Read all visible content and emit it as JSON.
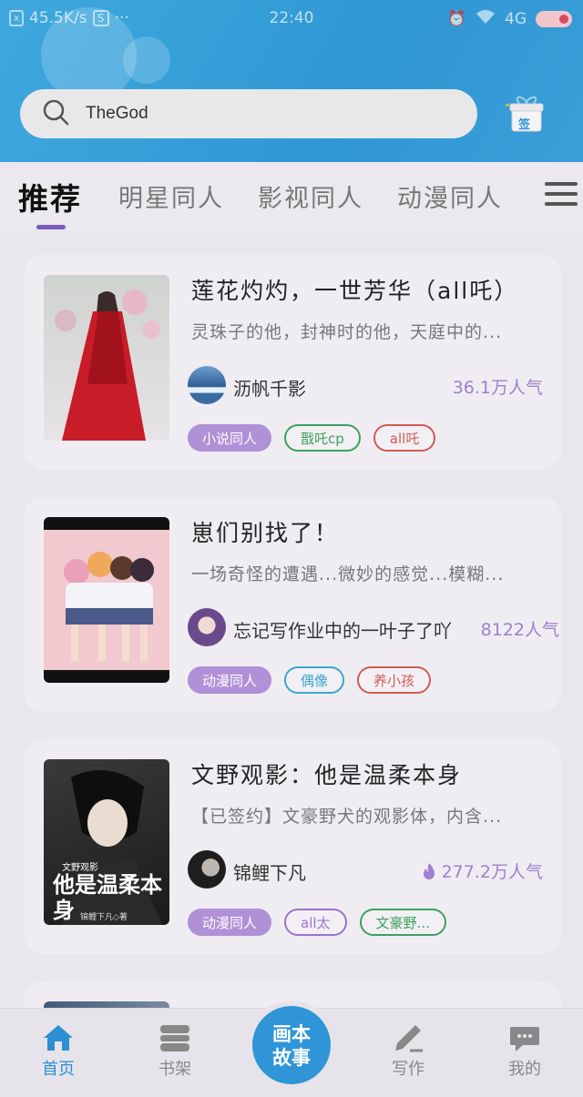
{
  "status_bar": {
    "speed": "45.5K/s",
    "time": "22:40",
    "signal": "4G"
  },
  "search": {
    "query": "TheGod",
    "icon": "search-icon"
  },
  "sign_in": {
    "label": "签"
  },
  "tabs": [
    {
      "label": "推荐"
    },
    {
      "label": "明星同人"
    },
    {
      "label": "影视同人"
    },
    {
      "label": "动漫同人"
    }
  ],
  "cards": [
    {
      "title": "莲花灼灼，一世芳华（all吒）",
      "desc": "灵珠子的他，封神时的他，天庭中的...",
      "author": "沥帆千影",
      "popularity": "36.1万人气",
      "tags": [
        {
          "label": "小说同人",
          "style": "purple"
        },
        {
          "label": "戬吒cp",
          "style": "green"
        },
        {
          "label": "all吒",
          "style": "red"
        }
      ]
    },
    {
      "title": "崽们别找了！",
      "desc": "一场奇怪的遭遇...微妙的感觉...模糊...",
      "author": "忘记写作业中的一叶子了吖",
      "popularity": "8122人气",
      "tags": [
        {
          "label": "动漫同人",
          "style": "purple"
        },
        {
          "label": "偶像",
          "style": "blue"
        },
        {
          "label": "养小孩",
          "style": "red"
        }
      ]
    },
    {
      "title": "文野观影：他是温柔本身",
      "desc": "【已签约】文豪野犬的观影体，内含...",
      "author": "锦鲤下凡",
      "popularity": "277.2万人气",
      "cover_text": "他是温柔本身",
      "cover_small": "文野观影",
      "cover_author": "锦鲤下凡◇著",
      "tags": [
        {
          "label": "动漫同人",
          "style": "purple"
        },
        {
          "label": "all太",
          "style": "violet"
        },
        {
          "label": "文豪野...",
          "style": "green"
        }
      ]
    }
  ],
  "bottom_nav": {
    "home": "首页",
    "bookshelf": "书架",
    "center": [
      "画本",
      "故事"
    ],
    "write": "写作",
    "mine": "我的"
  },
  "colors": {
    "brand": "#2f95d6",
    "accent": "#7a5bc0",
    "tag_purple": "#b090d6"
  }
}
